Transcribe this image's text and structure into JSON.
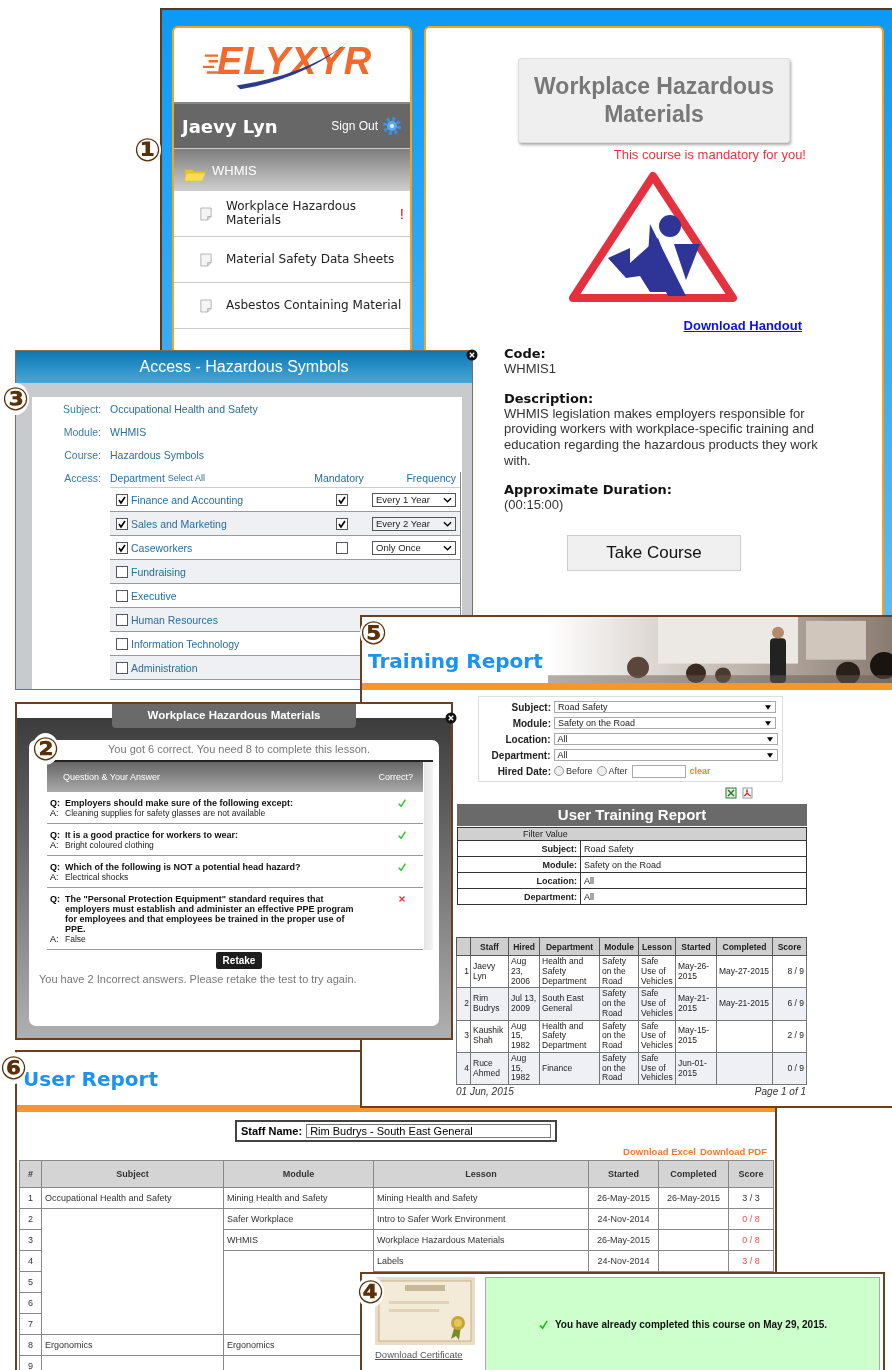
{
  "course_panel": {
    "marker": "①",
    "logo": "ELYXYR",
    "user": "Jaevy Lyn",
    "sign_out": "Sign Out",
    "module": "WHMIS",
    "lessons": [
      {
        "title": "Workplace Hazardous Materials",
        "flag": "!"
      },
      {
        "title": "Material Safety Data Sheets"
      },
      {
        "title": "Asbestos Containing Material"
      }
    ],
    "course_title": "Workplace Hazardous Materials",
    "mandatory_note": "This course is mandatory for you!",
    "handout_link": "Download Handout",
    "fields": [
      {
        "label": "Code:",
        "value": "WHMIS1"
      },
      {
        "label": "Description:",
        "value": "WHMIS legislation makes employers responsible for providing workers with workplace-specific training and education regarding the hazardous products they work with."
      },
      {
        "label": "Approximate Duration:",
        "value": "(00:15:00)"
      }
    ],
    "take_course": "Take Course"
  },
  "access_dialog": {
    "marker": "③",
    "title": "Access - Hazardous Symbols",
    "info": [
      {
        "label": "Subject:",
        "value": "Occupational Health and Safety"
      },
      {
        "label": "Module:",
        "value": "WHMIS"
      },
      {
        "label": "Course:",
        "value": "Hazardous Symbols"
      }
    ],
    "access_label": "Access:",
    "department_header": "Department",
    "select_all": "Select All",
    "mandatory_header": "Mandatory",
    "frequency_header": "Frequency",
    "departments": [
      {
        "name": "Finance and Accounting",
        "checked": true,
        "mandatory": true,
        "frequency": "Every 1 Year"
      },
      {
        "name": "Sales and Marketing",
        "checked": true,
        "mandatory": true,
        "frequency": "Every 2 Year"
      },
      {
        "name": "Caseworkers",
        "checked": true,
        "mandatory": false,
        "frequency": "Only Once"
      },
      {
        "name": "Fundraising",
        "checked": false
      },
      {
        "name": "Executive",
        "checked": false
      },
      {
        "name": "Human Resources",
        "checked": false
      },
      {
        "name": "Information Technology",
        "checked": false
      },
      {
        "name": "Administration",
        "checked": false
      }
    ]
  },
  "quiz_dialog": {
    "marker": "②",
    "title": "Workplace Hazardous Materials",
    "result": "You got 6 correct. You need 8 to complete this lesson.",
    "question_header": "Question & Your Answer",
    "correct_header": "Correct?",
    "items": [
      {
        "q": "Q:",
        "question": "Employers should make sure of the following except:",
        "a": "A:",
        "answer": "Cleaning supplies for safety glasses are not available",
        "correct": true
      },
      {
        "q": "Q:",
        "question": "It is a good practice for workers to wear:",
        "a": "A:",
        "answer": "Bright coloured clothing",
        "correct": true
      },
      {
        "q": "Q:",
        "question": "Which of the following is NOT a potential head hazard?",
        "a": "A:",
        "answer": "Electrical shocks",
        "correct": true
      },
      {
        "q": "Q:",
        "question": "The \"Personal Protection Equipment\" standard requires that employers must establish and administer an effective PPE program for employees and that employees be trained in the proper use of PPE.",
        "a": "A:",
        "answer": "False",
        "correct": false
      }
    ],
    "retake": "Retake",
    "message": "You have 2 Incorrect answers. Please retake the test to try again."
  },
  "training_report": {
    "marker": "⑤",
    "title": "Training Report",
    "filters": [
      {
        "label": "Subject:",
        "value": "Road Safety"
      },
      {
        "label": "Module:",
        "value": "Safety on the Road"
      },
      {
        "label": "Location:",
        "value": "All"
      },
      {
        "label": "Department:",
        "value": "All"
      }
    ],
    "hired_label": "Hired Date:",
    "hired_options": [
      {
        "label": "Before",
        "selected": false
      },
      {
        "label": "After",
        "selected": false
      }
    ],
    "clear": "clear",
    "report_title": "User Training Report",
    "filter_header": "Filter Value",
    "summary": [
      {
        "label": "Subject:",
        "value": "Road Safety"
      },
      {
        "label": "Module:",
        "value": "Safety on the Road"
      },
      {
        "label": "Location:",
        "value": "All"
      },
      {
        "label": "Department:",
        "value": "All"
      }
    ],
    "columns": [
      "Staff",
      "Hired",
      "Department",
      "Module",
      "Lesson",
      "Started",
      "Completed",
      "Score"
    ],
    "rows": [
      {
        "num": "1",
        "staff": "Jaevy Lyn",
        "hired": "Aug 23, 2006",
        "department": "Health and Safety Department",
        "module": "Safety on the Road",
        "lesson": "Safe Use of Vehicles",
        "started": "May-26-2015",
        "completed": "May-27-2015",
        "score": "8 / 9"
      },
      {
        "num": "2",
        "staff": "Rim Budrys",
        "hired": "Jul 13, 2009",
        "department": "South East General",
        "module": "Safety on the Road",
        "lesson": "Safe Use of Vehicles",
        "started": "May-21-2015",
        "completed": "May-21-2015",
        "score": "6 / 9"
      },
      {
        "num": "3",
        "staff": "Kaushik Shah",
        "hired": "Aug 15, 1982",
        "department": "Health and Safety Department",
        "module": "Safety on the Road",
        "lesson": "Safe Use of Vehicles",
        "started": "May-15-2015",
        "score": "2 / 9"
      },
      {
        "num": "4",
        "staff": "Ruce Ahmed",
        "hired": "Aug 15, 1982",
        "department": "Finance",
        "module": "Safety on the Road",
        "lesson": "Safe Use of Vehicles",
        "started": "Jun-01-2015",
        "score": "0 / 9"
      }
    ],
    "date": "01 Jun, 2015",
    "page": "Page 1 of 1"
  },
  "user_report": {
    "marker": "⑥",
    "title": "User Report",
    "staff_label": "Staff Name:",
    "staff_value": "Rim Budrys - South East General",
    "downloads": [
      "Download Excel",
      "Download PDF"
    ],
    "columns": [
      "#",
      "Subject",
      "Module",
      "Lesson",
      "Started",
      "Completed",
      "Score"
    ],
    "rows": [
      {
        "num": "1",
        "subject": "Occupational Health and Safety",
        "module": "Mining Health and Safety",
        "lesson": "Mining Health and Safety",
        "started": "26-May-2015",
        "completed": "26-May-2015",
        "score": "3 / 3",
        "passed": true
      },
      {
        "num": "2",
        "module": "Safer Workplace",
        "lesson": "Intro to Safer Work Environment",
        "started": "24-Nov-2014",
        "score": "0 / 8",
        "passed": false
      },
      {
        "num": "3",
        "module": "WHMIS",
        "lesson": "Workplace Hazardous Materials",
        "started": "26-May-2015",
        "score": "0 / 8",
        "passed": false
      },
      {
        "num": "4",
        "lesson": "Labels",
        "started": "24-Nov-2014",
        "score": "3 / 8",
        "passed": false
      },
      {
        "num": "5"
      },
      {
        "num": "6"
      },
      {
        "num": "7"
      },
      {
        "num": "8",
        "subject": "Ergonomics",
        "module": "Ergonomics"
      },
      {
        "num": "9"
      }
    ]
  },
  "certificate_panel": {
    "marker": "④",
    "link": "Download Certificate",
    "message": "You have already completed this course on May 29, 2015."
  }
}
